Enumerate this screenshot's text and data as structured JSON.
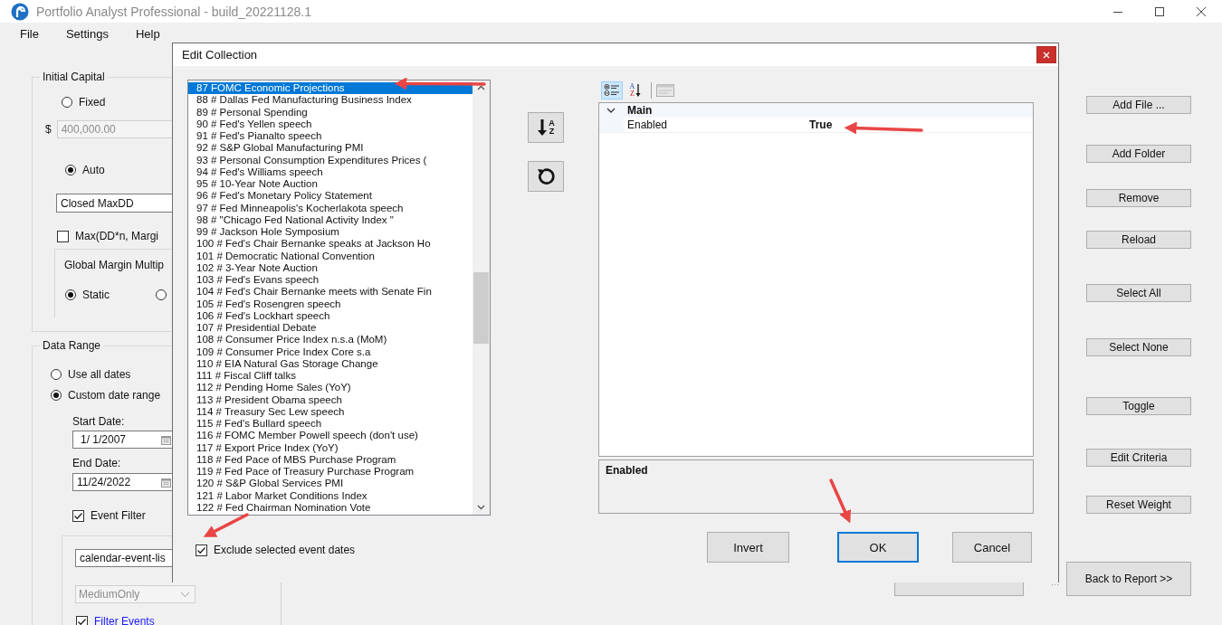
{
  "window": {
    "title": "Portfolio Analyst Professional - build_20221128.1"
  },
  "menu": [
    "File",
    "Settings",
    "Help"
  ],
  "initial_capital": {
    "title": "Initial Capital",
    "fixed": {
      "label": "Fixed",
      "selected": false
    },
    "amount_prefix": "$",
    "amount": {
      "value": "400,000.00",
      "disabled": true
    },
    "auto": {
      "label": "Auto",
      "selected": true
    },
    "method_field": "Closed MaxDD",
    "max_option": {
      "label": "Max(DD*n, Margi",
      "checked": false
    },
    "margin_label": "Global Margin Multip",
    "margin_modes": [
      {
        "label": "Static",
        "selected": true
      },
      {
        "selected": false
      }
    ]
  },
  "data_range": {
    "title": "Data Range",
    "modes": [
      {
        "label": "Use all dates",
        "selected": false
      },
      {
        "label": "Custom date range",
        "selected": true
      }
    ],
    "start_label": "Start Date:",
    "start_date": "1/  1/2007",
    "end_label": "End Date:",
    "end_date": "11/24/2022",
    "event_filter": {
      "label": "Event Filter",
      "checked": true
    },
    "event_list_field": "calendar-event-lis",
    "importance": {
      "value": "MediumOnly",
      "disabled": true
    },
    "filter_events": {
      "label": "Filter Events",
      "checked": true
    }
  },
  "side_buttons": [
    "Add File ...",
    "Add Folder",
    "Remove",
    "Reload",
    "Select All",
    "Select None",
    "Toggle",
    "Edit Criteria",
    "Reset Weight"
  ],
  "back_button": "Back to Report >>",
  "dialog": {
    "title": "Edit Collection",
    "items": [
      {
        "text": "87  FOMC Economic Projections",
        "selected": true
      },
      {
        "text": "88 # Dallas Fed Manufacturing Business Index",
        "selected": false
      },
      {
        "text": "89 # Personal Spending",
        "selected": false
      },
      {
        "text": "90 # Fed's Yellen speech",
        "selected": false
      },
      {
        "text": "91 # Fed's Pianalto speech",
        "selected": false
      },
      {
        "text": "92 # S&P Global Manufacturing PMI",
        "selected": false
      },
      {
        "text": "93 # Personal Consumption Expenditures Prices (",
        "selected": false
      },
      {
        "text": "94 # Fed's Williams speech",
        "selected": false
      },
      {
        "text": "95 # 10-Year Note Auction",
        "selected": false
      },
      {
        "text": "96 # Fed's Monetary Policy Statement",
        "selected": false
      },
      {
        "text": "97 # Fed Minneapolis's Kocherlakota speech",
        "selected": false
      },
      {
        "text": "98 # \"Chicago Fed National Activity Index \"",
        "selected": false
      },
      {
        "text": "99 # Jackson Hole Symposium",
        "selected": false
      },
      {
        "text": "100 # Fed's Chair Bernanke speaks at Jackson Ho",
        "selected": false
      },
      {
        "text": "101 # Democratic National Convention",
        "selected": false
      },
      {
        "text": "102 # 3-Year Note Auction",
        "selected": false
      },
      {
        "text": "103 # Fed's Evans speech",
        "selected": false
      },
      {
        "text": "104 # Fed's Chair Bernanke meets with Senate Fin",
        "selected": false
      },
      {
        "text": "105 # Fed's Rosengren speech",
        "selected": false
      },
      {
        "text": "106 # Fed's Lockhart speech",
        "selected": false
      },
      {
        "text": "107 # Presidential Debate",
        "selected": false
      },
      {
        "text": "108 # Consumer Price Index n.s.a (MoM)",
        "selected": false
      },
      {
        "text": "109 # Consumer Price Index Core s.a",
        "selected": false
      },
      {
        "text": "110 # EIA Natural Gas Storage Change",
        "selected": false
      },
      {
        "text": "111 # Fiscal Cliff talks",
        "selected": false
      },
      {
        "text": "112 # Pending Home Sales (YoY)",
        "selected": false
      },
      {
        "text": "113 # President Obama speech",
        "selected": false
      },
      {
        "text": "114 # Treasury Sec Lew speech",
        "selected": false
      },
      {
        "text": "115 # Fed's Bullard speech",
        "selected": false
      },
      {
        "text": "116 # FOMC Member Powell speech (don't use)",
        "selected": false
      },
      {
        "text": "117 # Export Price Index (YoY)",
        "selected": false
      },
      {
        "text": "118 # Fed Pace of MBS Purchase Program",
        "selected": false
      },
      {
        "text": "119 # Fed Pace of Treasury Purchase Program",
        "selected": false
      },
      {
        "text": "120 # S&P Global Services PMI",
        "selected": false
      },
      {
        "text": "121 # Labor Market Conditions Index",
        "selected": false
      },
      {
        "text": "122 # Fed Chairman Nomination Vote",
        "selected": false
      }
    ],
    "exclude": {
      "label": "Exclude selected event dates",
      "checked": true
    },
    "sort_letters": [
      "A",
      "Z"
    ],
    "view_modes": [
      {
        "kind": "categorized",
        "selected": true
      },
      {
        "kind": "alphabetical",
        "selected": false,
        "letters": [
          "A",
          "Z"
        ]
      }
    ],
    "category": {
      "label": "Main",
      "expanded": true
    },
    "properties": [
      {
        "name": "Enabled",
        "value": "True"
      }
    ],
    "description": "Enabled",
    "buttons": [
      {
        "label": "Invert",
        "focused": false
      },
      {
        "label": "OK",
        "focused": true
      },
      {
        "label": "Cancel",
        "focused": false
      }
    ]
  }
}
